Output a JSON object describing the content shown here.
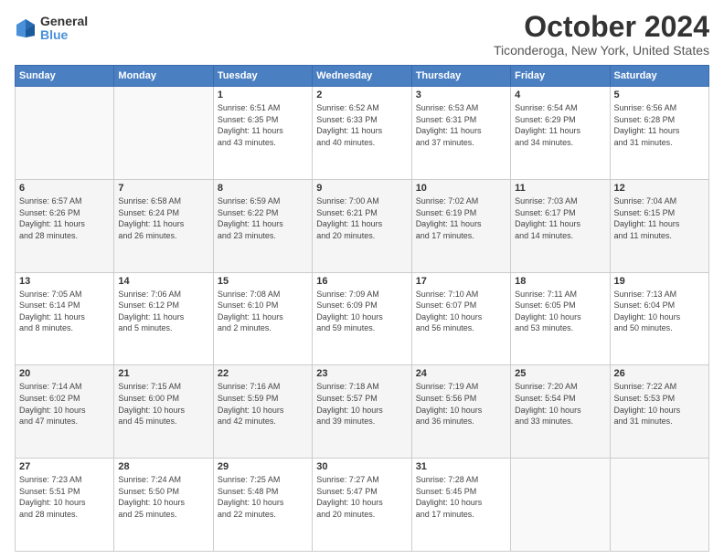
{
  "logo": {
    "general": "General",
    "blue": "Blue"
  },
  "header": {
    "month": "October 2024",
    "location": "Ticonderoga, New York, United States"
  },
  "days_of_week": [
    "Sunday",
    "Monday",
    "Tuesday",
    "Wednesday",
    "Thursday",
    "Friday",
    "Saturday"
  ],
  "weeks": [
    [
      {
        "day": "",
        "info": ""
      },
      {
        "day": "",
        "info": ""
      },
      {
        "day": "1",
        "info": "Sunrise: 6:51 AM\nSunset: 6:35 PM\nDaylight: 11 hours\nand 43 minutes."
      },
      {
        "day": "2",
        "info": "Sunrise: 6:52 AM\nSunset: 6:33 PM\nDaylight: 11 hours\nand 40 minutes."
      },
      {
        "day": "3",
        "info": "Sunrise: 6:53 AM\nSunset: 6:31 PM\nDaylight: 11 hours\nand 37 minutes."
      },
      {
        "day": "4",
        "info": "Sunrise: 6:54 AM\nSunset: 6:29 PM\nDaylight: 11 hours\nand 34 minutes."
      },
      {
        "day": "5",
        "info": "Sunrise: 6:56 AM\nSunset: 6:28 PM\nDaylight: 11 hours\nand 31 minutes."
      }
    ],
    [
      {
        "day": "6",
        "info": "Sunrise: 6:57 AM\nSunset: 6:26 PM\nDaylight: 11 hours\nand 28 minutes."
      },
      {
        "day": "7",
        "info": "Sunrise: 6:58 AM\nSunset: 6:24 PM\nDaylight: 11 hours\nand 26 minutes."
      },
      {
        "day": "8",
        "info": "Sunrise: 6:59 AM\nSunset: 6:22 PM\nDaylight: 11 hours\nand 23 minutes."
      },
      {
        "day": "9",
        "info": "Sunrise: 7:00 AM\nSunset: 6:21 PM\nDaylight: 11 hours\nand 20 minutes."
      },
      {
        "day": "10",
        "info": "Sunrise: 7:02 AM\nSunset: 6:19 PM\nDaylight: 11 hours\nand 17 minutes."
      },
      {
        "day": "11",
        "info": "Sunrise: 7:03 AM\nSunset: 6:17 PM\nDaylight: 11 hours\nand 14 minutes."
      },
      {
        "day": "12",
        "info": "Sunrise: 7:04 AM\nSunset: 6:15 PM\nDaylight: 11 hours\nand 11 minutes."
      }
    ],
    [
      {
        "day": "13",
        "info": "Sunrise: 7:05 AM\nSunset: 6:14 PM\nDaylight: 11 hours\nand 8 minutes."
      },
      {
        "day": "14",
        "info": "Sunrise: 7:06 AM\nSunset: 6:12 PM\nDaylight: 11 hours\nand 5 minutes."
      },
      {
        "day": "15",
        "info": "Sunrise: 7:08 AM\nSunset: 6:10 PM\nDaylight: 11 hours\nand 2 minutes."
      },
      {
        "day": "16",
        "info": "Sunrise: 7:09 AM\nSunset: 6:09 PM\nDaylight: 10 hours\nand 59 minutes."
      },
      {
        "day": "17",
        "info": "Sunrise: 7:10 AM\nSunset: 6:07 PM\nDaylight: 10 hours\nand 56 minutes."
      },
      {
        "day": "18",
        "info": "Sunrise: 7:11 AM\nSunset: 6:05 PM\nDaylight: 10 hours\nand 53 minutes."
      },
      {
        "day": "19",
        "info": "Sunrise: 7:13 AM\nSunset: 6:04 PM\nDaylight: 10 hours\nand 50 minutes."
      }
    ],
    [
      {
        "day": "20",
        "info": "Sunrise: 7:14 AM\nSunset: 6:02 PM\nDaylight: 10 hours\nand 47 minutes."
      },
      {
        "day": "21",
        "info": "Sunrise: 7:15 AM\nSunset: 6:00 PM\nDaylight: 10 hours\nand 45 minutes."
      },
      {
        "day": "22",
        "info": "Sunrise: 7:16 AM\nSunset: 5:59 PM\nDaylight: 10 hours\nand 42 minutes."
      },
      {
        "day": "23",
        "info": "Sunrise: 7:18 AM\nSunset: 5:57 PM\nDaylight: 10 hours\nand 39 minutes."
      },
      {
        "day": "24",
        "info": "Sunrise: 7:19 AM\nSunset: 5:56 PM\nDaylight: 10 hours\nand 36 minutes."
      },
      {
        "day": "25",
        "info": "Sunrise: 7:20 AM\nSunset: 5:54 PM\nDaylight: 10 hours\nand 33 minutes."
      },
      {
        "day": "26",
        "info": "Sunrise: 7:22 AM\nSunset: 5:53 PM\nDaylight: 10 hours\nand 31 minutes."
      }
    ],
    [
      {
        "day": "27",
        "info": "Sunrise: 7:23 AM\nSunset: 5:51 PM\nDaylight: 10 hours\nand 28 minutes."
      },
      {
        "day": "28",
        "info": "Sunrise: 7:24 AM\nSunset: 5:50 PM\nDaylight: 10 hours\nand 25 minutes."
      },
      {
        "day": "29",
        "info": "Sunrise: 7:25 AM\nSunset: 5:48 PM\nDaylight: 10 hours\nand 22 minutes."
      },
      {
        "day": "30",
        "info": "Sunrise: 7:27 AM\nSunset: 5:47 PM\nDaylight: 10 hours\nand 20 minutes."
      },
      {
        "day": "31",
        "info": "Sunrise: 7:28 AM\nSunset: 5:45 PM\nDaylight: 10 hours\nand 17 minutes."
      },
      {
        "day": "",
        "info": ""
      },
      {
        "day": "",
        "info": ""
      }
    ]
  ]
}
